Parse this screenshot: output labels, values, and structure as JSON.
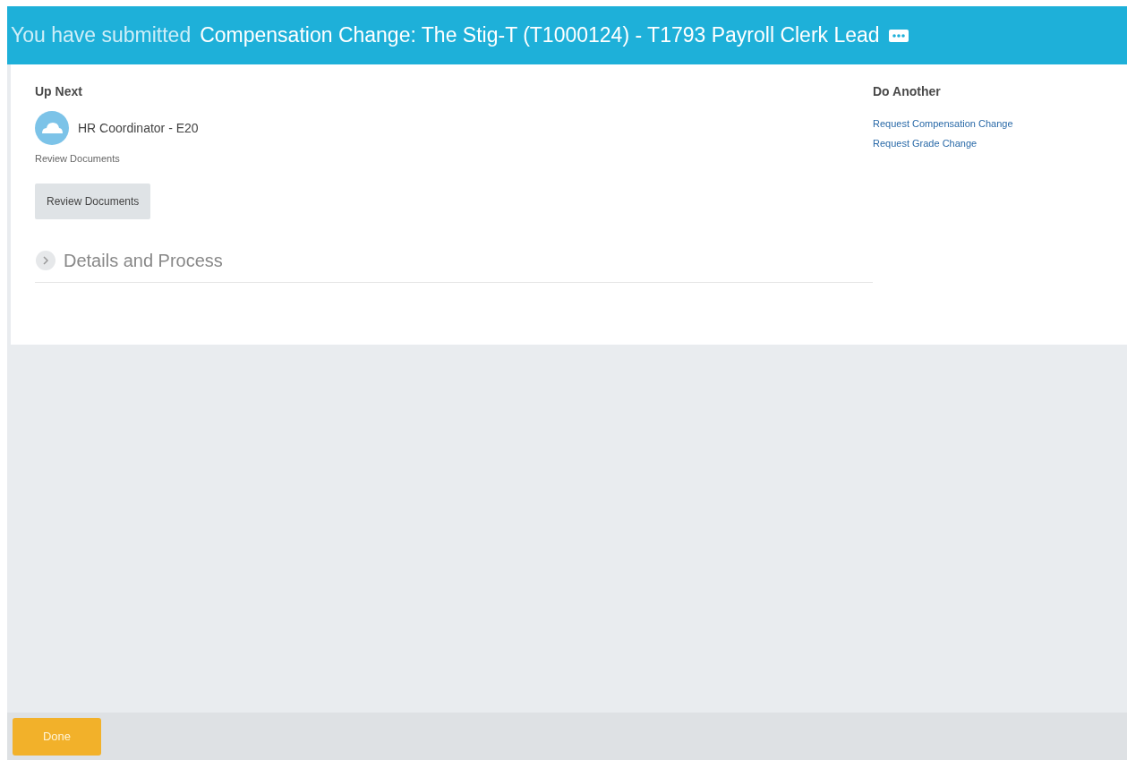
{
  "banner": {
    "prefix": "You have submitted",
    "title": "Compensation Change: The Stig-T (T1000124) - T1793 Payroll Clerk Lead"
  },
  "up_next": {
    "heading": "Up Next",
    "assignee": "HR Coordinator - E20",
    "task": "Review Documents",
    "button": "Review Documents"
  },
  "details": {
    "label": "Details and Process",
    "expanded": false
  },
  "do_another": {
    "heading": "Do Another",
    "links": [
      "Request Compensation Change",
      "Request Grade Change"
    ]
  },
  "footer": {
    "button": "Done"
  }
}
